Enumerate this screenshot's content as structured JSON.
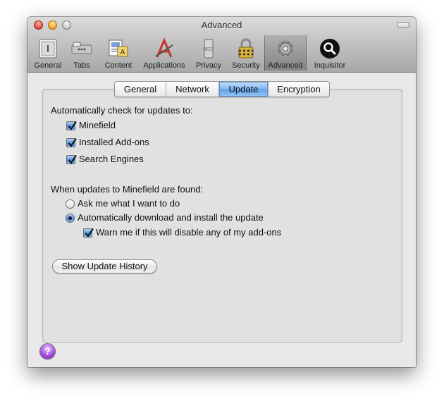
{
  "window": {
    "title": "Advanced"
  },
  "toolbar": {
    "items": [
      {
        "label": "General",
        "icon": "general-icon"
      },
      {
        "label": "Tabs",
        "icon": "tabs-icon"
      },
      {
        "label": "Content",
        "icon": "content-icon"
      },
      {
        "label": "Applications",
        "icon": "applications-icon"
      },
      {
        "label": "Privacy",
        "icon": "privacy-icon"
      },
      {
        "label": "Security",
        "icon": "security-icon"
      },
      {
        "label": "Advanced",
        "icon": "gear-icon",
        "selected": true
      },
      {
        "label": "Inquisitor",
        "icon": "inquisitor-icon"
      }
    ]
  },
  "tabs": [
    {
      "label": "General"
    },
    {
      "label": "Network"
    },
    {
      "label": "Update",
      "selected": true
    },
    {
      "label": "Encryption"
    }
  ],
  "update": {
    "auto_check_label": "Automatically check for updates to:",
    "checks": [
      {
        "label": "Minefield",
        "checked": true
      },
      {
        "label": "Installed Add-ons",
        "checked": true
      },
      {
        "label": "Search Engines",
        "checked": true
      }
    ],
    "when_found_label": "When updates to Minefield are found:",
    "radios": [
      {
        "label": "Ask me what I want to do",
        "selected": false
      },
      {
        "label": "Automatically download and install the update",
        "selected": true
      }
    ],
    "warn_label": "Warn me if this will disable any of my add-ons",
    "warn_checked": true,
    "history_button": "Show Update History"
  },
  "help": {
    "label": "?"
  }
}
